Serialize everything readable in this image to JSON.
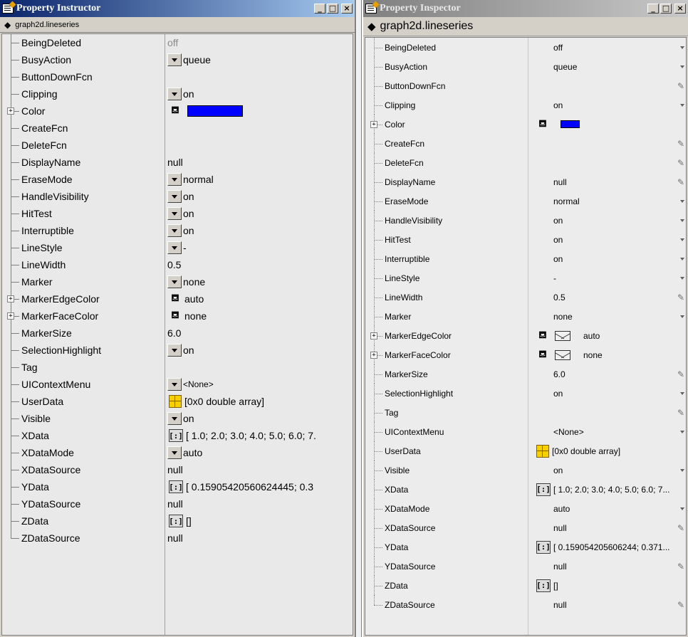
{
  "left": {
    "title": "Property Instructor",
    "object_label": "graph2d.lineseries",
    "props": [
      {
        "name": "BeingDeleted",
        "value": "off",
        "dim": true,
        "ctrl": ""
      },
      {
        "name": "BusyAction",
        "value": "queue",
        "ctrl": "dd"
      },
      {
        "name": "ButtonDownFcn",
        "value": "",
        "ctrl": ""
      },
      {
        "name": "Clipping",
        "value": "on",
        "ctrl": "dd"
      },
      {
        "name": "Color",
        "value": "",
        "ctrl": "color",
        "expand": true,
        "color": "#0000ff"
      },
      {
        "name": "CreateFcn",
        "value": "",
        "ctrl": ""
      },
      {
        "name": "DeleteFcn",
        "value": "",
        "ctrl": ""
      },
      {
        "name": "DisplayName",
        "value": "null",
        "ctrl": ""
      },
      {
        "name": "EraseMode",
        "value": "normal",
        "ctrl": "dd"
      },
      {
        "name": "HandleVisibility",
        "value": "on",
        "ctrl": "dd"
      },
      {
        "name": "HitTest",
        "value": "on",
        "ctrl": "dd"
      },
      {
        "name": "Interruptible",
        "value": "on",
        "ctrl": "dd"
      },
      {
        "name": "LineStyle",
        "value": "-",
        "ctrl": "dd"
      },
      {
        "name": "LineWidth",
        "value": "0.5",
        "ctrl": ""
      },
      {
        "name": "Marker",
        "value": "none",
        "ctrl": "dd"
      },
      {
        "name": "MarkerEdgeColor",
        "value": "auto",
        "ctrl": "bucket",
        "expand": true
      },
      {
        "name": "MarkerFaceColor",
        "value": "none",
        "ctrl": "bucket",
        "expand": true
      },
      {
        "name": "MarkerSize",
        "value": "6.0",
        "ctrl": ""
      },
      {
        "name": "SelectionHighlight",
        "value": "on",
        "ctrl": "dd"
      },
      {
        "name": "Tag",
        "value": "",
        "ctrl": ""
      },
      {
        "name": "UIContextMenu",
        "value": "<None>",
        "ctrl": "dd",
        "small": true
      },
      {
        "name": "UserData",
        "value": "[0x0  double array]",
        "ctrl": "grid"
      },
      {
        "name": "Visible",
        "value": "on",
        "ctrl": "dd"
      },
      {
        "name": "XData",
        "value": "[ 1.0; 2.0; 3.0; 4.0; 5.0; 6.0; 7.",
        "ctrl": "array"
      },
      {
        "name": "XDataMode",
        "value": "auto",
        "ctrl": "dd"
      },
      {
        "name": "XDataSource",
        "value": "null",
        "ctrl": ""
      },
      {
        "name": "YData",
        "value": "[ 0.15905420560624445; 0.3",
        "ctrl": "array"
      },
      {
        "name": "YDataSource",
        "value": "null",
        "ctrl": ""
      },
      {
        "name": "ZData",
        "value": "[]",
        "ctrl": "array"
      },
      {
        "name": "ZDataSource",
        "value": "null",
        "ctrl": ""
      }
    ]
  },
  "right": {
    "title": "Property Inspector",
    "object_label": "graph2d.lineseries",
    "props": [
      {
        "name": "BeingDeleted",
        "value": "off",
        "edge": "arrow"
      },
      {
        "name": "BusyAction",
        "value": "queue",
        "edge": "arrow"
      },
      {
        "name": "ButtonDownFcn",
        "value": "",
        "edge": "pencil"
      },
      {
        "name": "Clipping",
        "value": "on",
        "edge": "arrow"
      },
      {
        "name": "Color",
        "value": "",
        "ctrl": "color",
        "expand": true,
        "color": "#0000ff"
      },
      {
        "name": "CreateFcn",
        "value": "",
        "edge": "pencil"
      },
      {
        "name": "DeleteFcn",
        "value": "",
        "edge": "pencil"
      },
      {
        "name": "DisplayName",
        "value": "null",
        "edge": "pencil"
      },
      {
        "name": "EraseMode",
        "value": "normal",
        "edge": "arrow"
      },
      {
        "name": "HandleVisibility",
        "value": "on",
        "edge": "arrow"
      },
      {
        "name": "HitTest",
        "value": "on",
        "edge": "arrow"
      },
      {
        "name": "Interruptible",
        "value": "on",
        "edge": "arrow"
      },
      {
        "name": "LineStyle",
        "value": "-",
        "edge": "arrow"
      },
      {
        "name": "LineWidth",
        "value": "0.5",
        "edge": "pencil"
      },
      {
        "name": "Marker",
        "value": "none",
        "edge": "arrow"
      },
      {
        "name": "MarkerEdgeColor",
        "value": "auto",
        "ctrl": "bucket-env",
        "expand": true
      },
      {
        "name": "MarkerFaceColor",
        "value": "none",
        "ctrl": "bucket-env",
        "expand": true
      },
      {
        "name": "MarkerSize",
        "value": "6.0",
        "edge": "pencil"
      },
      {
        "name": "SelectionHighlight",
        "value": "on",
        "edge": "arrow"
      },
      {
        "name": "Tag",
        "value": "",
        "edge": "pencil"
      },
      {
        "name": "UIContextMenu",
        "value": "<None>",
        "edge": "arrow"
      },
      {
        "name": "UserData",
        "value": "[0x0  double array]",
        "ctrl": "grid"
      },
      {
        "name": "Visible",
        "value": "on",
        "edge": "arrow"
      },
      {
        "name": "XData",
        "value": "[ 1.0; 2.0; 3.0; 4.0; 5.0; 6.0; 7...",
        "ctrl": "array"
      },
      {
        "name": "XDataMode",
        "value": "auto",
        "edge": "arrow"
      },
      {
        "name": "XDataSource",
        "value": "null",
        "edge": "pencil"
      },
      {
        "name": "YData",
        "value": "[ 0.159054205606244; 0.371...",
        "ctrl": "array"
      },
      {
        "name": "YDataSource",
        "value": "null",
        "edge": "pencil"
      },
      {
        "name": "ZData",
        "value": "[]",
        "ctrl": "array"
      },
      {
        "name": "ZDataSource",
        "value": "null",
        "edge": "pencil"
      }
    ]
  },
  "window_buttons": {
    "minimize": "_",
    "maximize": "□",
    "close": "×"
  },
  "icons": {
    "object": "cube-icon",
    "bucket": "paint-bucket-icon",
    "array": "array-icon",
    "grid": "table-icon"
  }
}
